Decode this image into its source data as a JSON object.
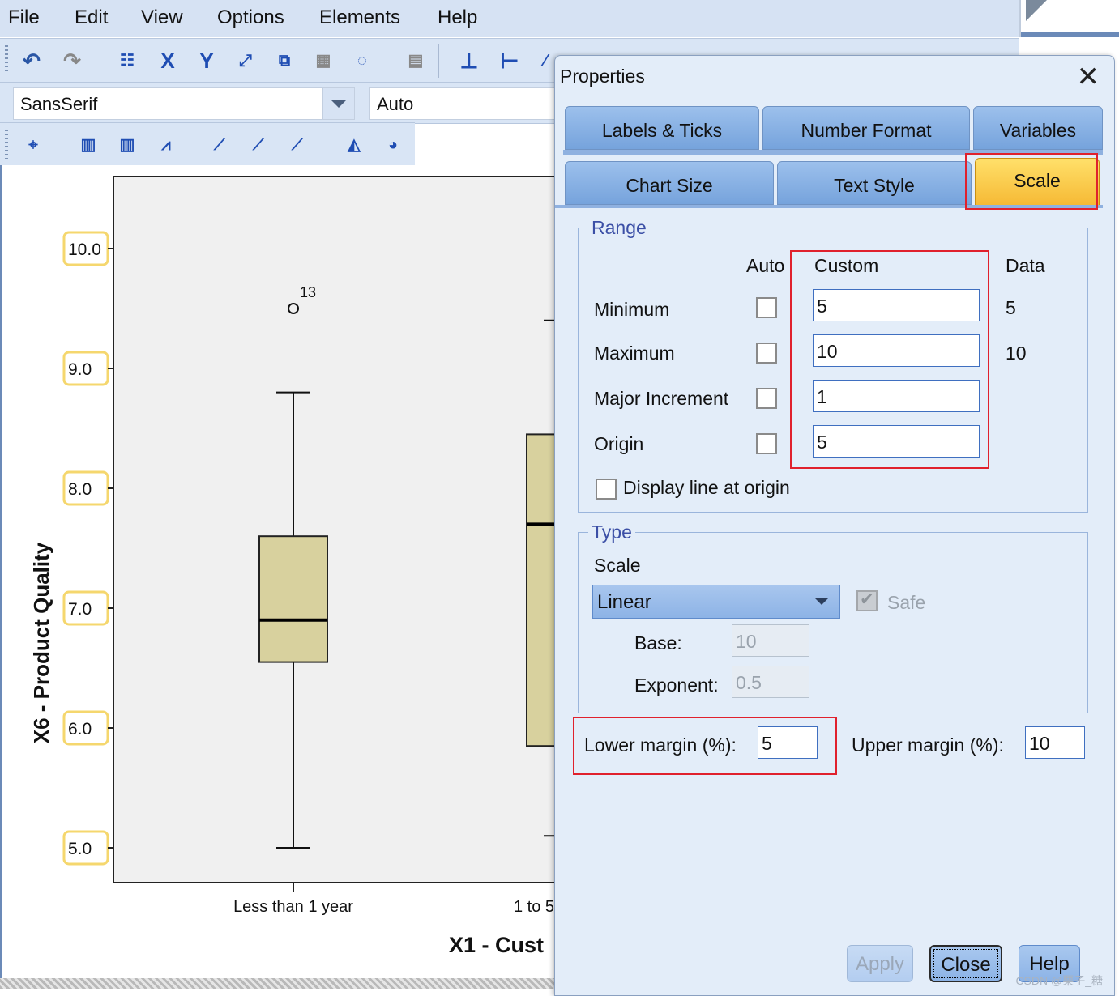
{
  "menu": [
    "File",
    "Edit",
    "View",
    "Options",
    "Elements",
    "Help"
  ],
  "toolbar2": {
    "font": "SansSerif",
    "size": "Auto"
  },
  "toolbar_icons": [
    "undo-icon",
    "redo-icon",
    "properties-icon",
    "x-axis-icon",
    "y-axis-icon",
    "scale-icon",
    "transform-icon",
    "3d-icon",
    "lasso-icon",
    "data-icon",
    "x-axis-line-icon",
    "y-axis-line-icon"
  ],
  "chart_data": {
    "type": "boxplot",
    "ylabel": "X6 - Product Quality",
    "xlabel": "X1 - Cust",
    "yticks": [
      "10.0",
      "9.0",
      "8.0",
      "7.0",
      "6.0",
      "5.0"
    ],
    "ylim": [
      5,
      10
    ],
    "categories": [
      "Less than 1 year",
      "1 to 5"
    ],
    "boxes": [
      {
        "category": "Less than 1 year",
        "min": 5.0,
        "q1": 6.55,
        "median": 6.9,
        "q3": 7.6,
        "max": 8.8,
        "outliers": [
          {
            "label": "13",
            "value": 9.5
          }
        ]
      },
      {
        "category": "1 to 5",
        "min": 5.1,
        "q1": 5.85,
        "median": 7.7,
        "q3": 8.45,
        "max": 9.4,
        "outliers": []
      }
    ],
    "fill": "#d8d19e",
    "plot_bg": "#f0f0f0"
  },
  "dialog": {
    "title": "Properties",
    "tabs_row1": [
      "Labels & Ticks",
      "Number Format",
      "Variables"
    ],
    "tabs_row2": [
      "Chart Size",
      "Text Style",
      "Scale"
    ],
    "selected_tab": "Scale",
    "range": {
      "legend": "Range",
      "col_auto": "Auto",
      "col_custom": "Custom",
      "col_data": "Data",
      "rows": [
        {
          "label": "Minimum",
          "custom": "5",
          "data": "5"
        },
        {
          "label": "Maximum",
          "custom": "10",
          "data": "10"
        },
        {
          "label": "Major Increment",
          "custom": "1",
          "data": ""
        },
        {
          "label": "Origin",
          "custom": "5",
          "data": ""
        }
      ],
      "display_line": "Display line at origin"
    },
    "type": {
      "legend": "Type",
      "scale_label": "Scale",
      "scale_value": "Linear",
      "safe_label": "Safe",
      "base_label": "Base:",
      "base_value": "10",
      "exponent_label": "Exponent:",
      "exponent_value": "0.5"
    },
    "margins": {
      "lower_label": "Lower margin (%):",
      "lower_value": "5",
      "upper_label": "Upper margin (%):",
      "upper_value": "10"
    },
    "buttons": {
      "apply": "Apply",
      "close": "Close",
      "help": "Help"
    },
    "watermark": "CSDN @栗子_糖"
  },
  "colors": {
    "highlight": "#e0212d",
    "tab_selected": "#f6b934",
    "tick_highlight": "#f5d76e"
  }
}
